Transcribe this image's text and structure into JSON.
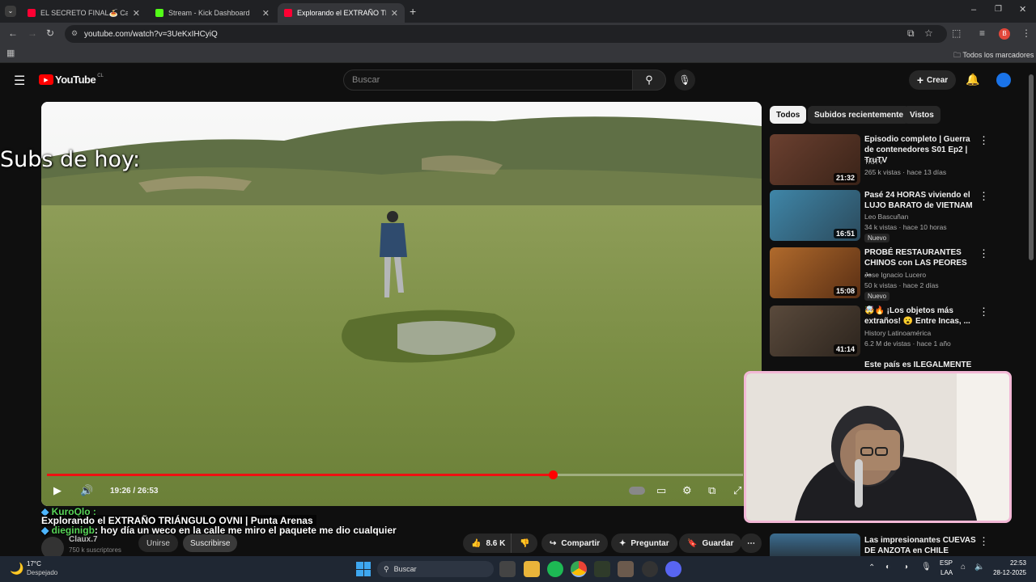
{
  "browser": {
    "tabs": [
      {
        "title": "EL SECRETO FINAL🍝 Capítulo",
        "fav_color": "#ff0033"
      },
      {
        "title": "Stream - Kick Dashboard",
        "fav_color": "#53fc18"
      },
      {
        "title": "Explorando el EXTRAÑO TRIÁN",
        "fav_color": "#ff0033"
      }
    ],
    "url": "youtube.com/watch?v=3UeKxIHCyiQ",
    "bookmarks_label": "Todos los marcadores",
    "profile_initial": "B"
  },
  "youtube": {
    "logo_text": "YouTube",
    "country": "CL",
    "search_placeholder": "Buscar",
    "create_label": "Crear"
  },
  "player": {
    "time": "19:26 / 26:53",
    "progress": 0.727
  },
  "filters": [
    "Todos",
    "Subidos recientemente",
    "Vistos"
  ],
  "recommendations": [
    {
      "title": "Episodio completo | Guerra de contenedores S01 Ep2 | TruTV",
      "channel": "TruTV",
      "meta": "265 k vistas · hace 13 días",
      "duration": "21:32",
      "new": "",
      "thumb": "#5a3a2c"
    },
    {
      "title": "Pasé 24 HORAS viviendo el LUJO BARATO de VIETNAM",
      "channel": "Leo Bascuñan",
      "meta": "34 k vistas · hace 10 horas",
      "duration": "16:51",
      "new": "Nuevo",
      "thumb": "#3a6f8c"
    },
    {
      "title": "PROBÉ RESTAURANTES CHINOS con LAS PEORES ...",
      "channel": "Jose Ignacio Lucero",
      "meta": "50 k vistas · hace 2 días",
      "duration": "15:08",
      "new": "Nuevo",
      "thumb": "#8a4a22"
    },
    {
      "title": "🤯🔥 ¡Los objetos más extraños! 😮 Entre Incas, ...",
      "channel": "History Latinoamérica",
      "meta": "6.2 M de vistas · hace 1 año",
      "duration": "41:14",
      "new": "",
      "thumb": "#4a3b30"
    }
  ],
  "partial_rec_titles": [
    "Este país es ILEGALMENTE",
    "Las impresionantes CUEVAS DE ANZOTA en CHILE"
  ],
  "channel": {
    "name": "Claux.7",
    "subs": "750 k suscriptores",
    "join_label": "Unirse",
    "subscribe_label": "Suscribirse"
  },
  "actions": {
    "likes": "8.6 K",
    "share": "Compartir",
    "ask": "Preguntar",
    "save": "Guardar"
  },
  "overlay": {
    "subs_text": "Subs de hoy:",
    "chat": [
      {
        "user": "KuroQlo :",
        "msg": ""
      },
      {
        "user": "",
        "msg": "Explorando el EXTRAÑO TRIÁNGULO OVNI | Punta Arenas"
      },
      {
        "user": "dieginigb",
        "msg": ": hoy día un weco en la calle me miro el paquete me dio cualquier"
      }
    ]
  },
  "taskbar": {
    "weather_temp": "17°C",
    "weather_desc": "Despejado",
    "search_label": "Buscar",
    "lang": "ESP",
    "lang2": "LAA",
    "time": "22:53",
    "date": "28-12-2025"
  },
  "colors": {
    "accent": "#ff0000",
    "cam_border": "#f3b8d6"
  }
}
